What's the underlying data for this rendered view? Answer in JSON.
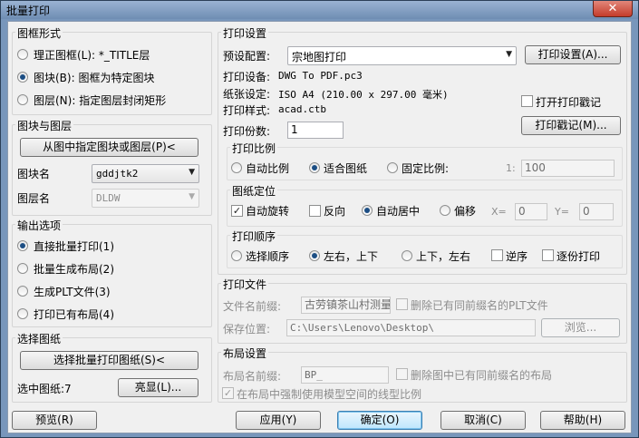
{
  "window": {
    "title": "批量打印",
    "close_glyph": "✕"
  },
  "frame_style": {
    "label": "图框形式",
    "options": [
      {
        "label": "理正图框(L): *_TITLE层",
        "selected": false
      },
      {
        "label": "图块(B): 图框为特定图块",
        "selected": true
      },
      {
        "label": "图层(N): 指定图层封闭矩形",
        "selected": false
      }
    ]
  },
  "block_layer": {
    "label": "图块与图层",
    "pick_button": "从图中指定图块或图层(P)<",
    "block_name_label": "图块名",
    "block_name_value": "gddjtk2",
    "layer_name_label": "图层名",
    "layer_name_value": "DLDW"
  },
  "output": {
    "label": "输出选项",
    "options": [
      {
        "label": "直接批量打印(1)",
        "selected": true
      },
      {
        "label": "批量生成布局(2)",
        "selected": false
      },
      {
        "label": "生成PLT文件(3)",
        "selected": false
      },
      {
        "label": "打印已有布局(4)",
        "selected": false
      }
    ]
  },
  "select_drawings": {
    "label": "选择图纸",
    "select_button": "选择批量打印图纸(S)<",
    "selected_count_label": "选中图纸:7",
    "highlight_button": "亮显(L)..."
  },
  "print_settings": {
    "label": "打印设置",
    "preset_label": "预设配置:",
    "preset_value": "宗地图打印",
    "settings_button": "打印设置(A)...",
    "device_label": "打印设备:",
    "device_value": "DWG To PDF.pc3",
    "paper_label": "纸张设定:",
    "paper_value": "ISO A4 (210.00 x 297.00 毫米)",
    "style_label": "打印样式:",
    "style_value": "acad.ctb",
    "open_stamp_label": "打开打印戳记",
    "copies_label": "打印份数:",
    "copies_value": "1",
    "stamp_button": "打印戳记(M)..."
  },
  "print_scale": {
    "label": "打印比例",
    "options": [
      {
        "label": "自动比例",
        "selected": false
      },
      {
        "label": "适合图纸",
        "selected": true
      },
      {
        "label": "固定比例:",
        "selected": false
      }
    ],
    "ratio_prefix": "1:",
    "ratio_value": "100"
  },
  "paper_position": {
    "label": "图纸定位",
    "auto_rotate_label": "自动旋转",
    "auto_rotate_checked": true,
    "reverse_label": "反向",
    "reverse_checked": false,
    "auto_center_label": "自动居中",
    "offset_label": "偏移",
    "x_label": "X=",
    "x_value": "0",
    "y_label": "Y=",
    "y_value": "0"
  },
  "print_order": {
    "label": "打印顺序",
    "options": [
      {
        "label": "选择顺序",
        "selected": false
      },
      {
        "label": "左右，上下",
        "selected": true
      },
      {
        "label": "上下，左右",
        "selected": false
      }
    ],
    "reverse_label": "逆序",
    "copy_by_copy_label": "逐份打印"
  },
  "print_file": {
    "label": "打印文件",
    "prefix_label": "文件名前缀:",
    "prefix_value": "古劳镇茶山村测量",
    "delete_plt_label": "删除已有同前缀名的PLT文件",
    "save_label": "保存位置:",
    "save_value": "C:\\Users\\Lenovo\\Desktop\\",
    "browse_button": "浏览..."
  },
  "layout_settings": {
    "label": "布局设置",
    "prefix_label": "布局名前缀:",
    "prefix_value": "BP_",
    "delete_layout_label": "删除图中已有同前缀名的布局",
    "force_linetype_label": "在布局中强制使用模型空间的线型比例"
  },
  "footer": {
    "preview": "预览(R)",
    "apply": "应用(Y)",
    "ok": "确定(O)",
    "cancel": "取消(C)",
    "help": "帮助(H)"
  },
  "glyphs": {
    "check": "✓",
    "dropdown": "▼"
  }
}
